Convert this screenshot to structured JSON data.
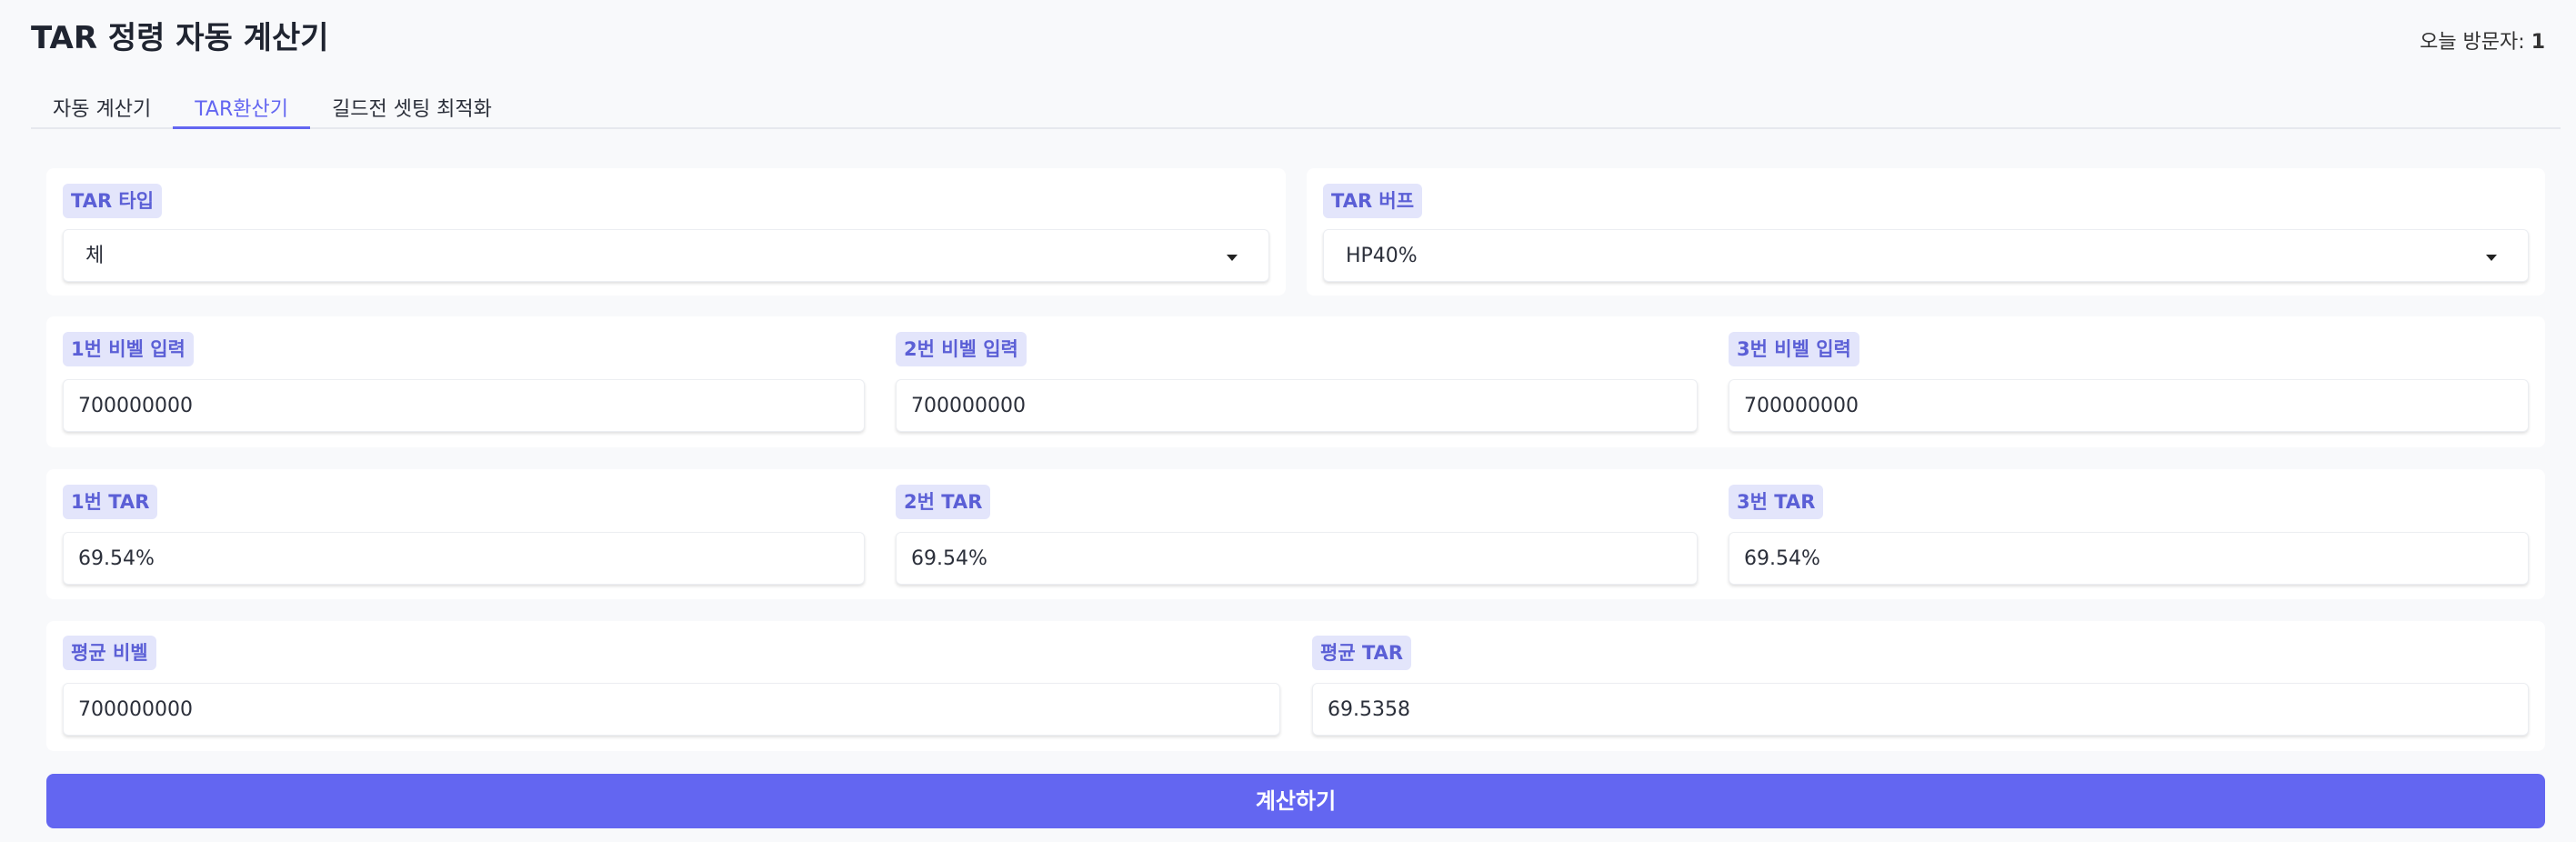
{
  "app": {
    "title": "TAR 정령 자동 계산기"
  },
  "visitors": {
    "label": "오늘 방문자:",
    "count": "1"
  },
  "tabs": [
    {
      "label": "자동 계산기"
    },
    {
      "label": "TAR환산기"
    },
    {
      "label": "길드전 셋팅 최적화"
    }
  ],
  "type_select": {
    "label": "TAR 타입",
    "value": "체"
  },
  "buff_select": {
    "label": "TAR 버프",
    "value": "HP40%"
  },
  "bibel_inputs": [
    {
      "label": "1번 비벨 입력",
      "value": "700000000"
    },
    {
      "label": "2번 비벨 입력",
      "value": "700000000"
    },
    {
      "label": "3번 비벨 입력",
      "value": "700000000"
    }
  ],
  "tar_outputs": [
    {
      "label": "1번 TAR",
      "value": "69.54%"
    },
    {
      "label": "2번 TAR",
      "value": "69.54%"
    },
    {
      "label": "3번 TAR",
      "value": "69.54%"
    }
  ],
  "average": {
    "bibel_label": "평균 비벨",
    "bibel_value": "700000000",
    "tar_label": "평균 TAR",
    "tar_value": "69.5358"
  },
  "calculate_button": {
    "label": "계산하기"
  },
  "colors": {
    "accent": "#6366f1",
    "label_bg": "#e3e5fb",
    "label_text": "#5b5fd6"
  }
}
